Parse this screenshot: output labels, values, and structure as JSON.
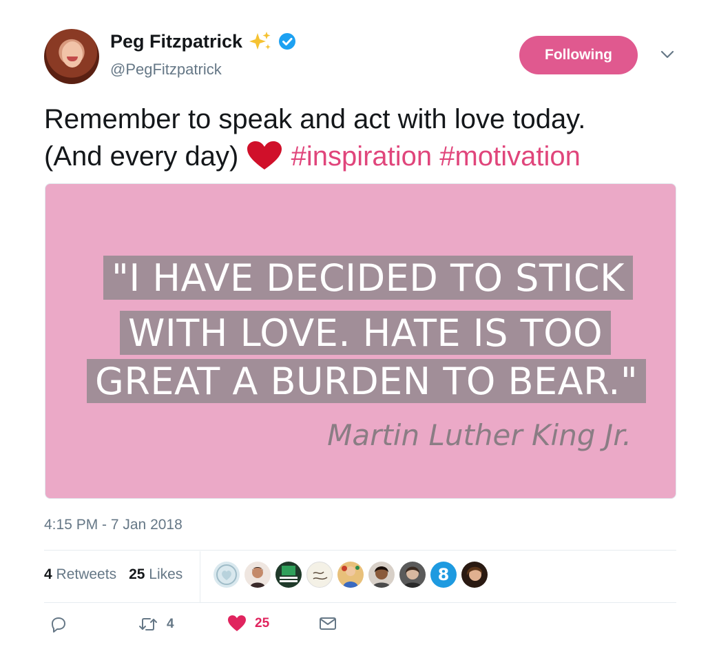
{
  "user": {
    "display_name": "Peg Fitzpatrick",
    "handle": "@PegFitzpatrick",
    "emoji_icon": "sparkles-icon",
    "verified_icon": "verified-badge-icon"
  },
  "follow_button": {
    "label": "Following",
    "color": "#e0598f"
  },
  "tweet": {
    "line1": "Remember to speak and act with love today.",
    "line2": "(And every day)",
    "hashtags": [
      "#inspiration",
      "#motivation"
    ],
    "hashtag_color": "#e0457b",
    "heart_icon": "red-heart-emoji-icon"
  },
  "media": {
    "background": "#eba9c7",
    "quote_lines": [
      "\"I HAVE DECIDED TO STICK",
      "WITH LOVE. HATE IS TOO",
      "GREAT A BURDEN TO BEAR.\""
    ],
    "attribution": "Martin Luther King Jr."
  },
  "timestamp": "4:15 PM - 7 Jan 2018",
  "stats": {
    "retweets_count": "4",
    "retweets_label": "Retweets",
    "likes_count": "25",
    "likes_label": "Likes"
  },
  "likers": [
    {
      "icon": "liker-avatar-1",
      "color": "#cfe3ea"
    },
    {
      "icon": "liker-avatar-2",
      "color": "#7a4a3a"
    },
    {
      "icon": "liker-avatar-3",
      "color": "#1f3a2a"
    },
    {
      "icon": "liker-avatar-4",
      "color": "#f4f1e6"
    },
    {
      "icon": "liker-avatar-5",
      "color": "#d69a5a"
    },
    {
      "icon": "liker-avatar-6",
      "color": "#5a3a2a"
    },
    {
      "icon": "liker-avatar-7",
      "color": "#6a6a6a"
    },
    {
      "icon": "liker-avatar-8",
      "color": "#1e9ae0"
    },
    {
      "icon": "liker-avatar-9",
      "color": "#3a2418"
    }
  ],
  "actions": {
    "reply_count": "",
    "retweet_count": "4",
    "like_count": "25",
    "like_color": "#e0245e"
  }
}
